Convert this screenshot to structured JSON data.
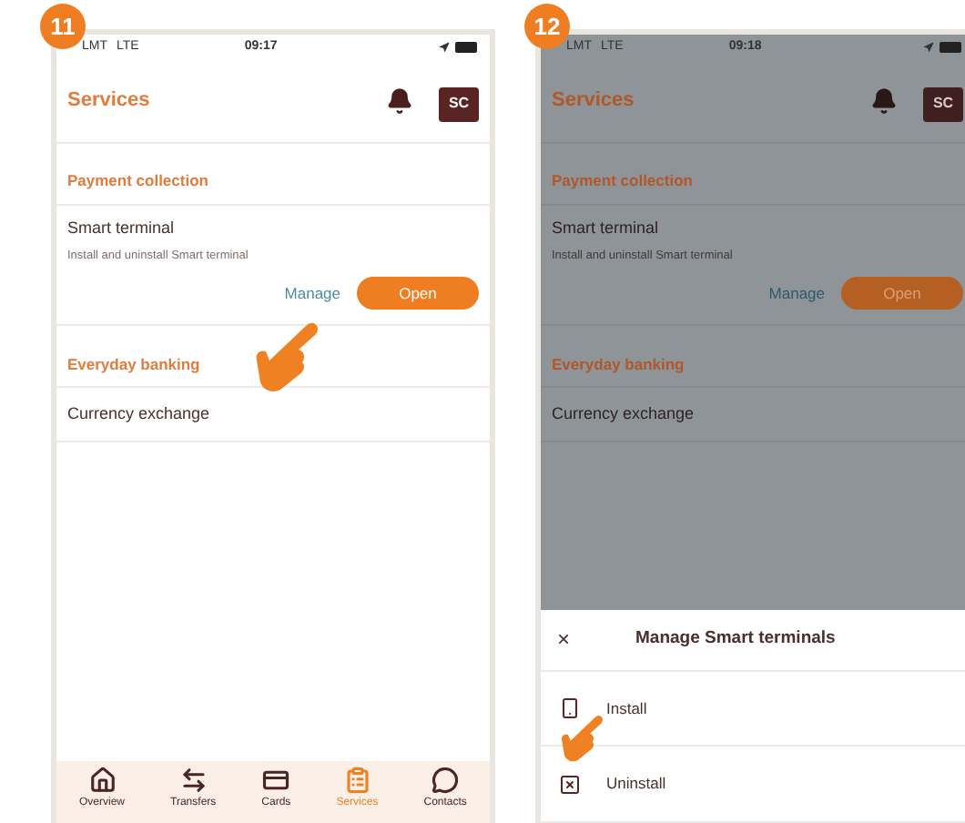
{
  "steps": [
    {
      "number": "11",
      "dimmed": false,
      "status": {
        "carrier": "LMT",
        "network": "LTE",
        "time": "09:17"
      },
      "header": {
        "title": "Services",
        "avatar": "SC"
      },
      "sections": [
        {
          "title": "Payment collection",
          "items": [
            {
              "title": "Smart terminal",
              "subtitle": "Install and uninstall Smart terminal",
              "link": "Manage",
              "button": "Open",
              "pointed": true
            }
          ]
        },
        {
          "title": "Everyday banking",
          "items": [
            {
              "title": "Currency exchange"
            }
          ]
        }
      ],
      "tab_bar": [
        {
          "label": "Overview",
          "kind": "home",
          "selected": false
        },
        {
          "label": "Transfers",
          "kind": "transfers",
          "selected": false
        },
        {
          "label": "Cards",
          "kind": "card",
          "selected": false
        },
        {
          "label": "Services",
          "kind": "services",
          "selected": true
        },
        {
          "label": "Contacts",
          "kind": "chat",
          "selected": false
        }
      ]
    },
    {
      "number": "12",
      "dimmed": true,
      "status": {
        "carrier": "LMT",
        "network": "LTE",
        "time": "09:18"
      },
      "header": {
        "title": "Services",
        "avatar": "SC"
      },
      "sections": [
        {
          "title": "Payment collection",
          "items": [
            {
              "title": "Smart terminal",
              "subtitle": "Install and uninstall Smart terminal",
              "link": "Manage",
              "button": "Open",
              "pointed": false
            }
          ]
        },
        {
          "title": "Everyday banking",
          "items": [
            {
              "title": "Currency exchange"
            }
          ]
        }
      ],
      "sheet": {
        "close": "×",
        "title": "Manage Smart terminals",
        "options": [
          {
            "label": "Install",
            "kind": "install",
            "pointed": true
          },
          {
            "label": "Uninstall",
            "kind": "uninstall",
            "pointed": false
          }
        ]
      }
    }
  ]
}
